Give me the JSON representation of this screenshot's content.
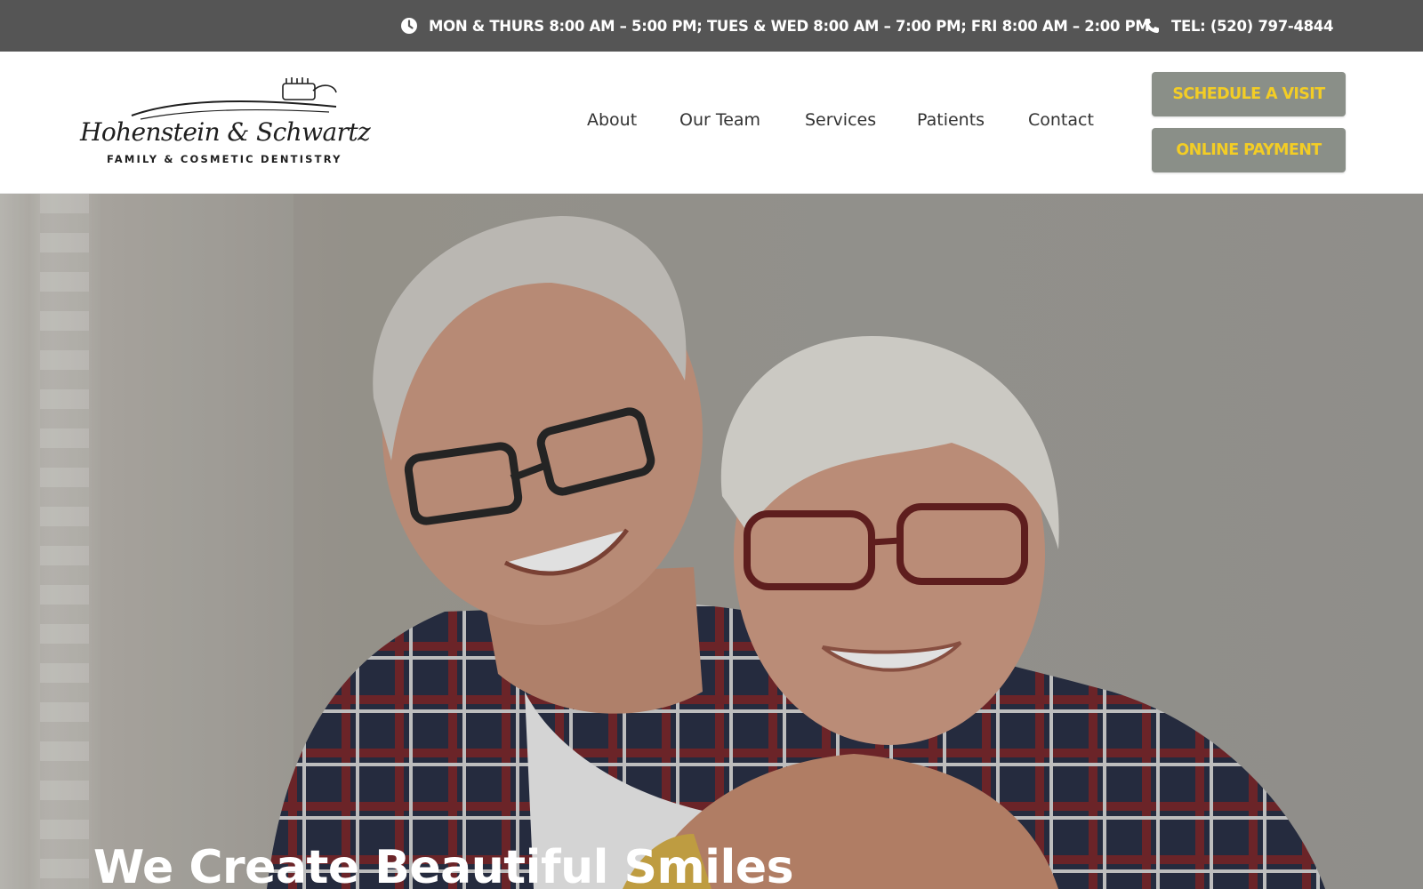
{
  "topbar": {
    "hours": "MON & THURS 8:00 AM – 5:00 PM; TUES & WED 8:00 AM – 7:00 PM; FRI 8:00 AM – 2:00 PM",
    "phone": "TEL: (520) 797-4844",
    "hours_icon": "clock-icon",
    "phone_icon": "phone-icon"
  },
  "logo": {
    "name": "Hohenstein & Schwartz",
    "tagline": "FAMILY & COSMETIC DENTISTRY"
  },
  "nav": {
    "items": [
      {
        "label": "About"
      },
      {
        "label": "Our Team"
      },
      {
        "label": "Services"
      },
      {
        "label": "Patients"
      },
      {
        "label": "Contact"
      }
    ]
  },
  "cta": {
    "schedule": "SCHEDULE A VISIT",
    "payment": "ONLINE PAYMENT"
  },
  "hero": {
    "headline": "We Create Beautiful Smiles"
  },
  "colors": {
    "topbar_bg": "#555555",
    "cta_bg": "#8a8f88",
    "cta_text": "#f3cd25"
  }
}
